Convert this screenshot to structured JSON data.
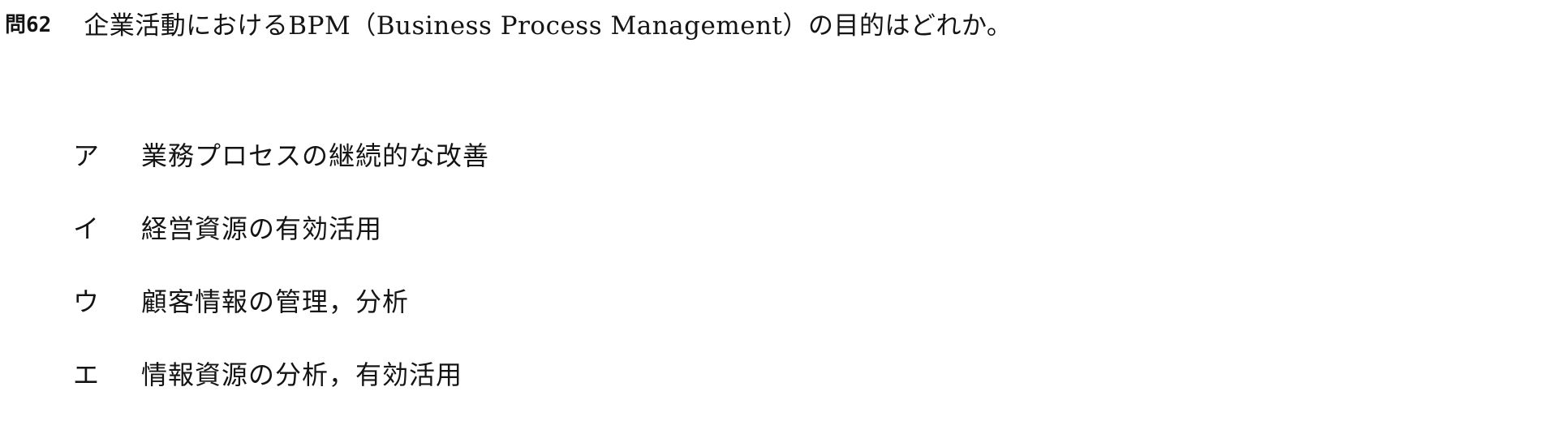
{
  "question": {
    "number": "問62",
    "text": "企業活動におけるBPM（Business Process Management）の目的はどれか。"
  },
  "choices": [
    {
      "letter": "ア",
      "text": "業務プロセスの継続的な改善"
    },
    {
      "letter": "イ",
      "text": "経営資源の有効活用"
    },
    {
      "letter": "ウ",
      "text": "顧客情報の管理，分析"
    },
    {
      "letter": "エ",
      "text": "情報資源の分析，有効活用"
    }
  ]
}
